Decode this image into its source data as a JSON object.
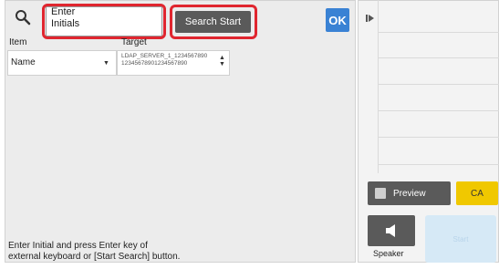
{
  "search": {
    "initials_text": "Enter\nInitials",
    "search_start_label": "Search Start",
    "ok_label": "OK"
  },
  "columns": {
    "item_header": "Item",
    "target_header": "Target"
  },
  "item_select": {
    "value": "Name"
  },
  "target_select": {
    "line1": "LDAP_SERVER_1_1234567890",
    "line2": "12345678901234567890"
  },
  "message": "Enter Initial and press Enter key of\nexternal keyboard or [Start Search] button.",
  "right_panel": {
    "preview_label": "Preview",
    "ca_label": "CA",
    "speaker_label": "Speaker",
    "start_label": "Start"
  },
  "colors": {
    "highlight": "#e0262f",
    "ok_blue": "#3a82d4",
    "ca_yellow": "#f0c800",
    "start_light_blue": "#d6e9f6"
  },
  "icons": [
    "search-icon",
    "play-icon",
    "preview-icon",
    "speaker-icon",
    "dropdown-arrow-icon",
    "spinner-arrow-icon"
  ]
}
